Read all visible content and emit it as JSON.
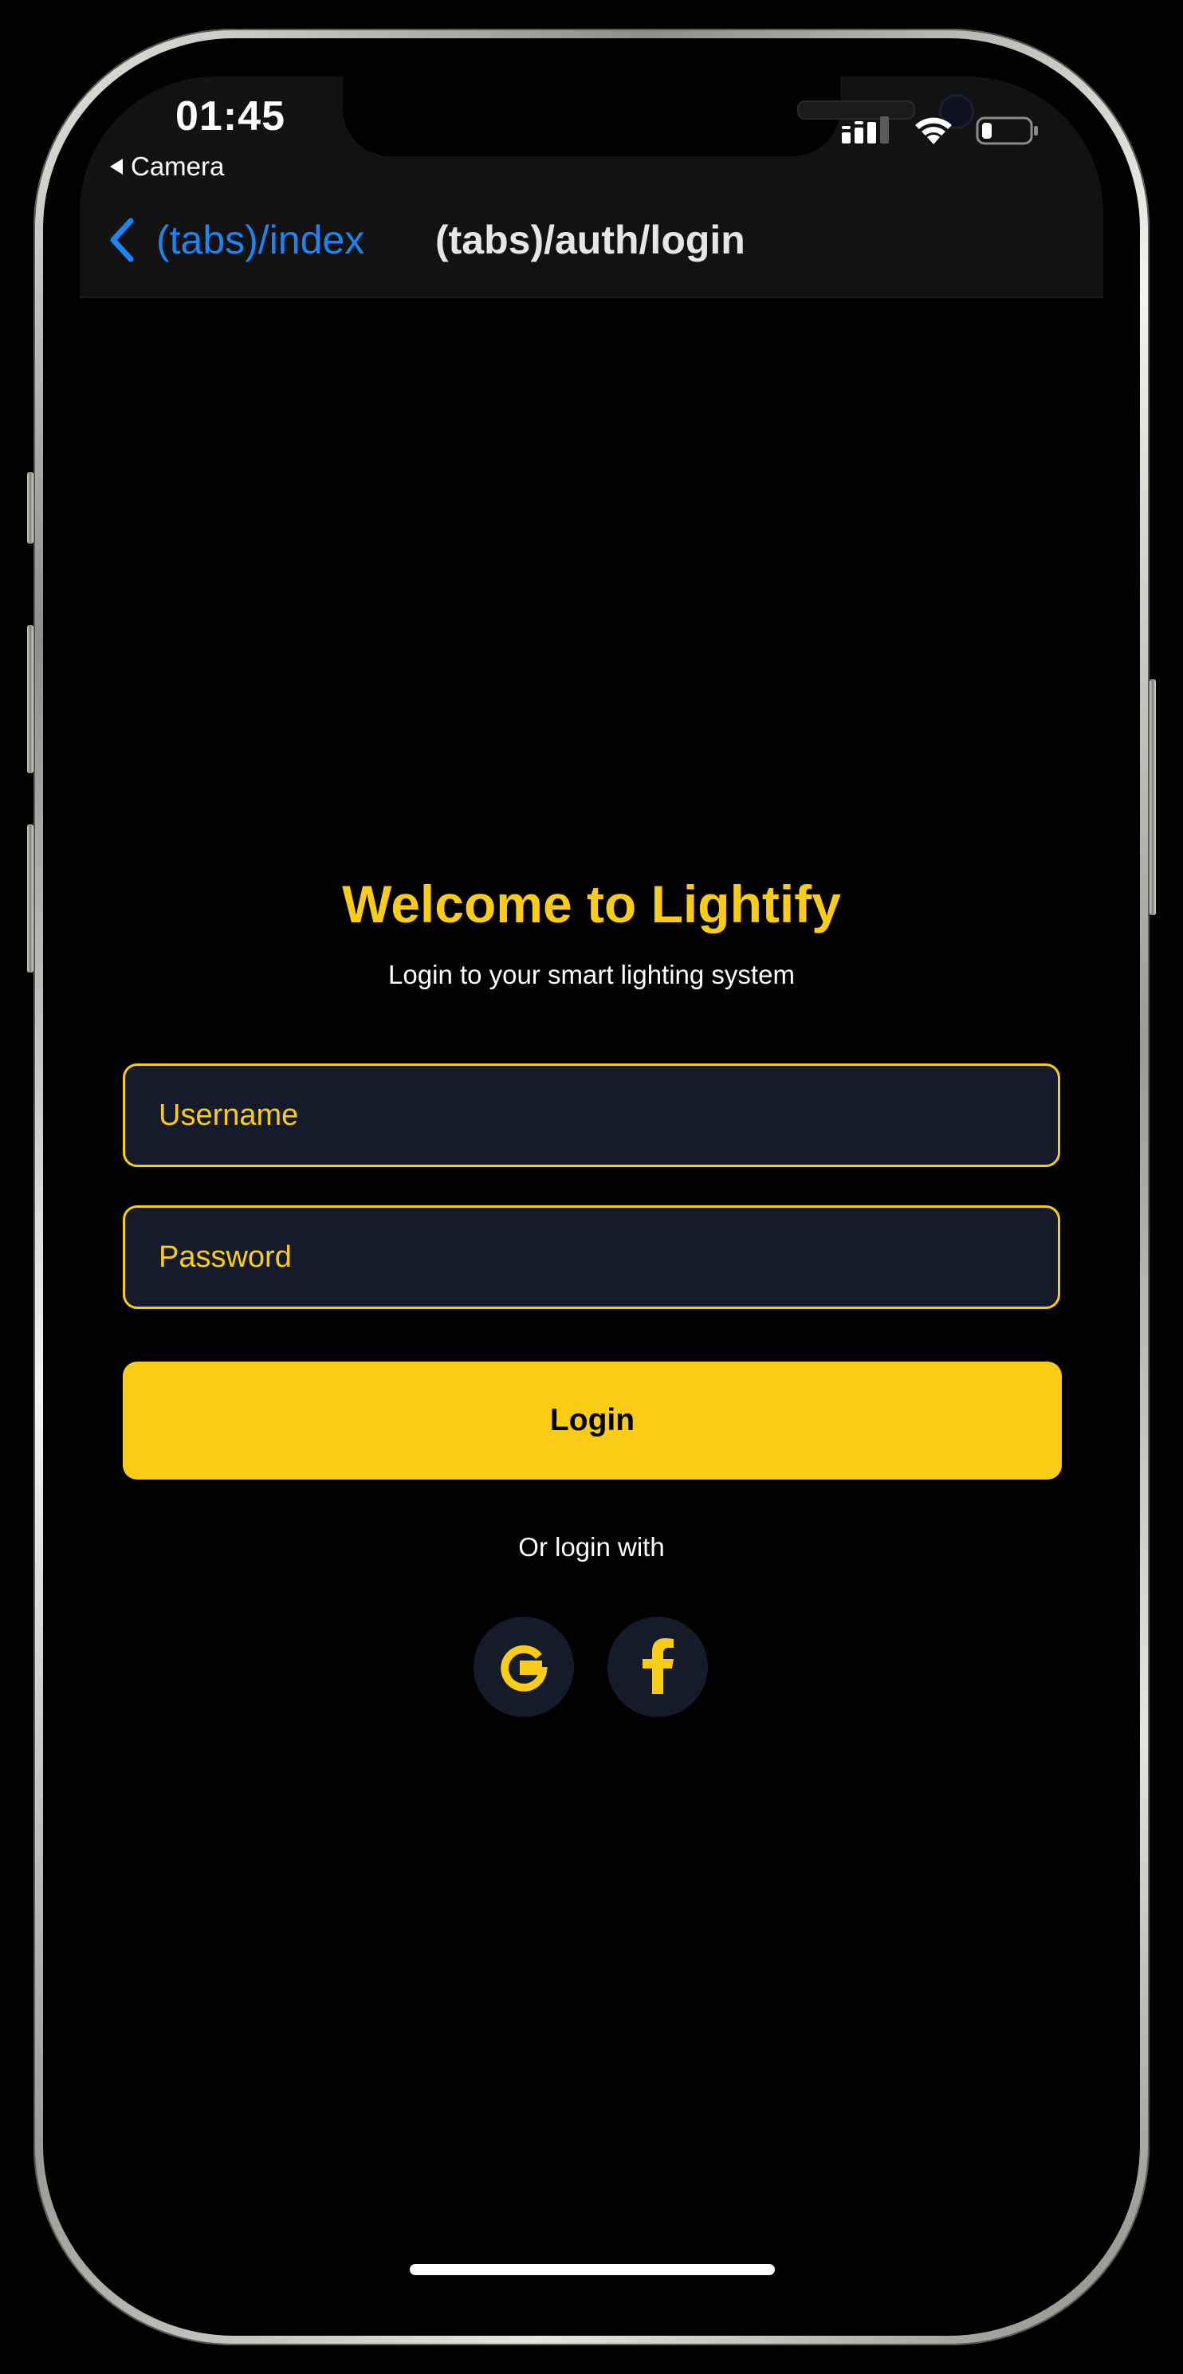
{
  "status_bar": {
    "time": "01:45",
    "back_app_label": "Camera",
    "icons": [
      "cellular-signal-icon",
      "wifi-icon",
      "battery-icon"
    ]
  },
  "nav_bar": {
    "back_label": "(tabs)/index",
    "title": "(tabs)/auth/login"
  },
  "login": {
    "heading": "Welcome to Lightify",
    "subtitle": "Login to your smart lighting system",
    "username_placeholder": "Username",
    "password_placeholder": "Password",
    "login_button": "Login",
    "alt_login_text": "Or login with",
    "social": [
      {
        "icon": "google-icon"
      },
      {
        "icon": "facebook-icon"
      }
    ]
  },
  "colors": {
    "accent": "#facc15",
    "link": "#1d85f2",
    "input_bg": "#151b2b",
    "background": "#000000",
    "header_bg": "#121212"
  }
}
